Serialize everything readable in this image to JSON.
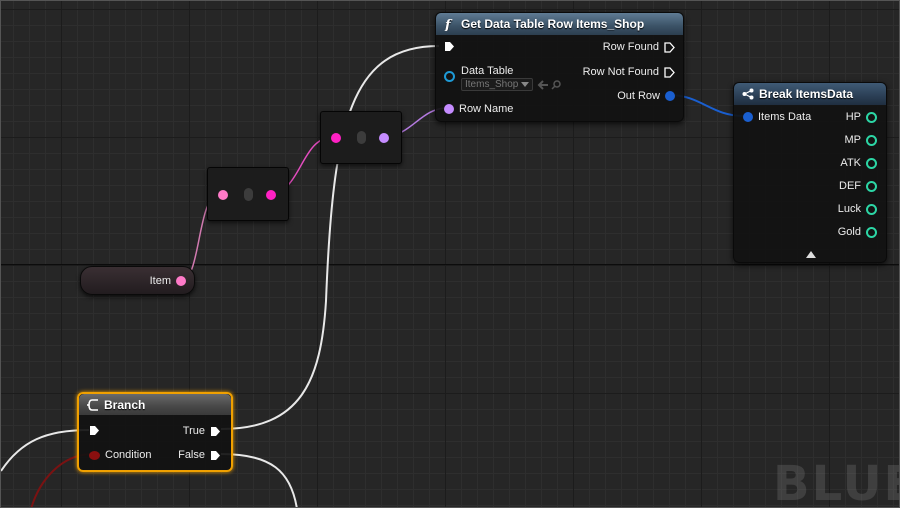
{
  "nodes": {
    "get_data_table_row": {
      "title": "Get Data Table Row Items_Shop",
      "pins": {
        "data_table": "Data Table",
        "data_table_value": "Items_Shop",
        "row_name": "Row Name",
        "row_found": "Row Found",
        "row_not_found": "Row Not Found",
        "out_row": "Out Row"
      }
    },
    "break_items_data": {
      "title": "Break ItemsData",
      "input": "Items Data",
      "outputs": [
        "HP",
        "MP",
        "ATK",
        "DEF",
        "Luck",
        "Gold"
      ]
    },
    "item_variable": {
      "label": "Item"
    },
    "branch": {
      "title": "Branch",
      "condition": "Condition",
      "true_label": "True",
      "false_label": "False"
    }
  },
  "watermark": "BLUEPRINT",
  "colors": {
    "exec": "#ffffff",
    "struct": "#1a5fd0",
    "data_table": "#1e9ad6",
    "name": "#c58cff",
    "string": "#ff21c4",
    "integer": "#2cd6a5",
    "boolean": "#8a0f0f",
    "selection": "#f0a000"
  }
}
